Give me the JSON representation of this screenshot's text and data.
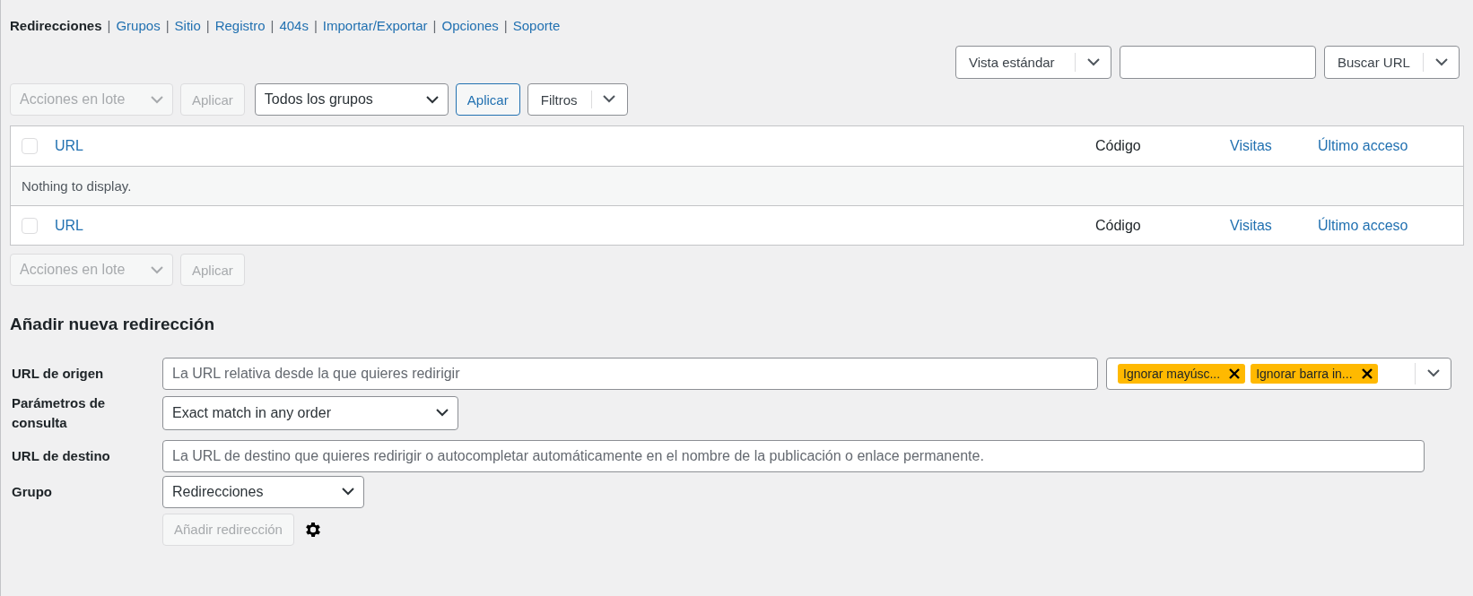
{
  "nav": [
    {
      "label": "Redirecciones",
      "selected": true
    },
    {
      "separator": "|",
      "label": "Grupos",
      "selected": false
    },
    {
      "separator": "|",
      "label": "Sitio",
      "selected": false
    },
    {
      "separator": "|",
      "label": "Registro",
      "selected": false
    },
    {
      "separator": "|",
      "label": "404s",
      "selected": false
    },
    {
      "separator": "|",
      "label": "Importar/Exportar",
      "selected": false
    },
    {
      "separator": "|",
      "label": "Opciones",
      "selected": false
    },
    {
      "separator": "|",
      "label": "Soporte",
      "selected": false
    }
  ],
  "top_controls": {
    "view_select": "Vista estándar",
    "search_button": "Buscar URL"
  },
  "bulk_top": {
    "bulk_select": {
      "label": "Acciones en lote",
      "disabled": true
    },
    "apply": {
      "label": "Aplicar",
      "disabled": true
    },
    "group_select": "Todos los grupos",
    "group_apply": "Aplicar",
    "filters": "Filtros"
  },
  "table": {
    "columns": [
      {
        "label": "URL",
        "sortable": true
      },
      {
        "label": "Código",
        "sortable": false
      },
      {
        "label": "Visitas",
        "sortable": true
      },
      {
        "label": "Último acceso",
        "sortable": true
      }
    ],
    "footer_columns": [
      {
        "label": "URL",
        "sortable": true
      },
      {
        "label": "Código",
        "sortable": false
      },
      {
        "label": "Visitas",
        "sortable": true
      },
      {
        "label": "Último acceso",
        "sortable": true
      }
    ],
    "header_checked": false,
    "empty_message": "Nothing to display.",
    "footer_checked": false
  },
  "bulk_bottom": {
    "bulk_select": {
      "label": "Acciones en lote",
      "disabled": true
    },
    "apply": {
      "label": "Aplicar",
      "disabled": true
    }
  },
  "add_form": {
    "title": "Añadir nueva redirección",
    "source": {
      "label": "URL de origen",
      "placeholder": "La URL relativa desde la que quieres redirigir",
      "tags": [
        "Ignorar mayúsc...",
        "Ignorar barra in..."
      ]
    },
    "query": {
      "label": "Parámetros de consulta",
      "value": "Exact match in any order"
    },
    "target": {
      "label": "URL de destino",
      "placeholder": "La URL de destino que quieres redirigir o autocompletar automáticamente en el nombre de la publicación o enlace permanente."
    },
    "group": {
      "label": "Grupo",
      "value": "Redirecciones"
    },
    "submit": {
      "label": "Añadir redirección",
      "disabled": true
    }
  }
}
